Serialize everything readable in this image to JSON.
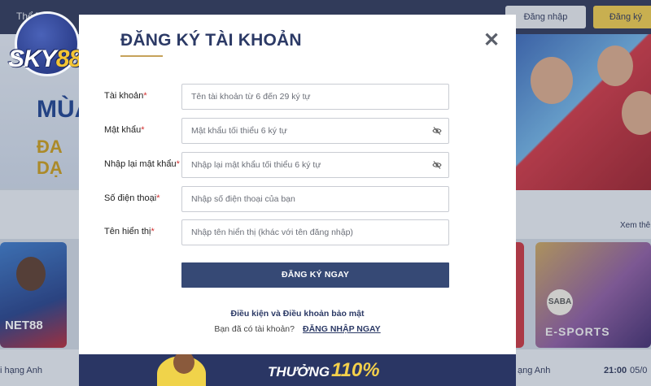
{
  "header": {
    "nav_fragment": "Thể Th",
    "login_button": "Đăng nhập",
    "register_button": "Đăng ký"
  },
  "logo": {
    "brand_text": "SKY",
    "brand_number": "88"
  },
  "hero": {
    "left_line1": "MÙA",
    "left_line2": "ĐA DẠ"
  },
  "section": {
    "see_all": "Xem thê"
  },
  "cards": {
    "left_sponsor": "NET88",
    "esports_badge": "SABA",
    "esports_label": "E-SPORTS"
  },
  "bottom": {
    "left_text": "i hạng Anh",
    "mid_text": "ạng Anh",
    "time": "21:00",
    "date": "05/0"
  },
  "modal": {
    "title": "ĐĂNG KÝ TÀI KHOẢN",
    "close_symbol": "✕",
    "fields": [
      {
        "label": "Tài khoản",
        "placeholder": "Tên tài khoản từ 6 đến 29 ký tự",
        "value": ""
      },
      {
        "label": "Mật khẩu",
        "placeholder": "Mật khẩu tối thiểu 6 ký tự",
        "value": ""
      },
      {
        "label": "Nhập lại mật khẩu",
        "placeholder": "Nhập lại mật khẩu tối thiểu 6 ký tự",
        "value": ""
      },
      {
        "label": "Số điện thoại",
        "placeholder": "Nhập số điện thoại của bạn",
        "value": ""
      },
      {
        "label": "Tên hiển thị",
        "placeholder": "Nhập tên hiển thị (khác với tên đăng nhập)",
        "value": ""
      }
    ],
    "required_mark": "*",
    "submit_button": "ĐĂNG KÝ NGAY",
    "terms_link": "Điều kiện và Điều khoản bảo mật",
    "have_account_text": "Bạn đã có tài khoản?",
    "login_link": "ĐĂNG NHẬP NGAY"
  },
  "promo": {
    "text": "THƯỞNG",
    "percent": "110%"
  },
  "icons": {
    "close": "close-icon",
    "eye": "eye-off-icon"
  },
  "colors": {
    "primary_navy": "#2c3a66",
    "button_navy": "#364975",
    "accent_gold": "#c6a25a",
    "required_red": "#d32f2f",
    "register_yellow": "#eec94b"
  }
}
